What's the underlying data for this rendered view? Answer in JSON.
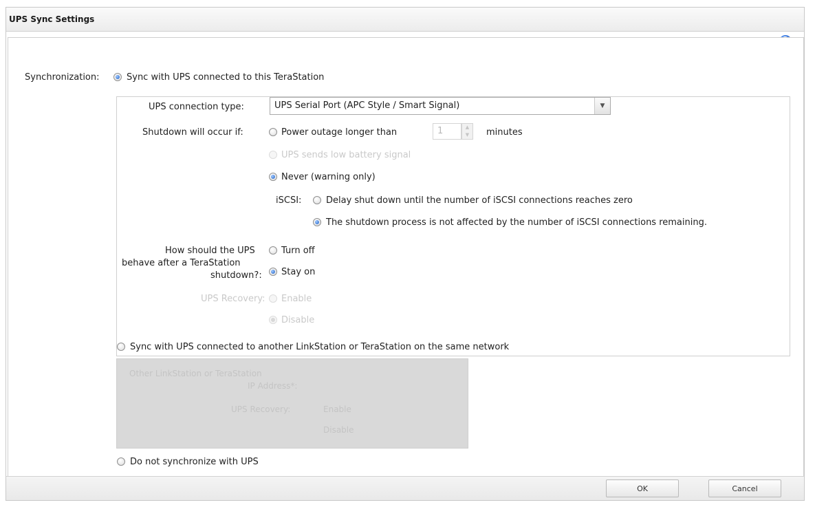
{
  "dialog": {
    "title": "UPS Sync Settings"
  },
  "help": {
    "icon": "question-circle-icon",
    "caret": "▾"
  },
  "sync": {
    "label": "Synchronization:",
    "option_this": "Sync with UPS connected to this TeraStation",
    "option_other": "Sync with UPS connected to another LinkStation or TeraStation on the same network",
    "option_none": "Do not synchronize with UPS",
    "selected": "option_this"
  },
  "connection": {
    "label": "UPS connection type:",
    "value": "UPS Serial Port (APC Style / Smart Signal)"
  },
  "shutdown": {
    "label": "Shutdown will occur if:",
    "power_outage": "Power outage longer than",
    "minutes_value": "1",
    "minutes_unit": "minutes",
    "low_battery": "UPS sends low battery signal",
    "never": "Never (warning only)",
    "selected": "never"
  },
  "iscsi": {
    "label": "iSCSI:",
    "delay": "Delay shut down until the number of iSCSI connections reaches zero",
    "not_affected": "The shutdown process is not affected by the number of iSCSI connections remaining.",
    "selected": "not_affected"
  },
  "behavior": {
    "label_line1": "How should the UPS",
    "label_line2": "behave after a TeraStation",
    "label_line3": "shutdown?:",
    "turn_off": "Turn off",
    "stay_on": "Stay on",
    "selected": "stay_on"
  },
  "recovery": {
    "label": "UPS Recovery:",
    "enable": "Enable",
    "disable": "Disable"
  },
  "other_panel": {
    "ip_label_line1": "Other LinkStation or TeraStation",
    "ip_label_line2": "IP Address*:",
    "recovery_label": "UPS Recovery:",
    "enable": "Enable",
    "disable": "Disable"
  },
  "footer": {
    "ok": "OK",
    "cancel": "Cancel"
  }
}
